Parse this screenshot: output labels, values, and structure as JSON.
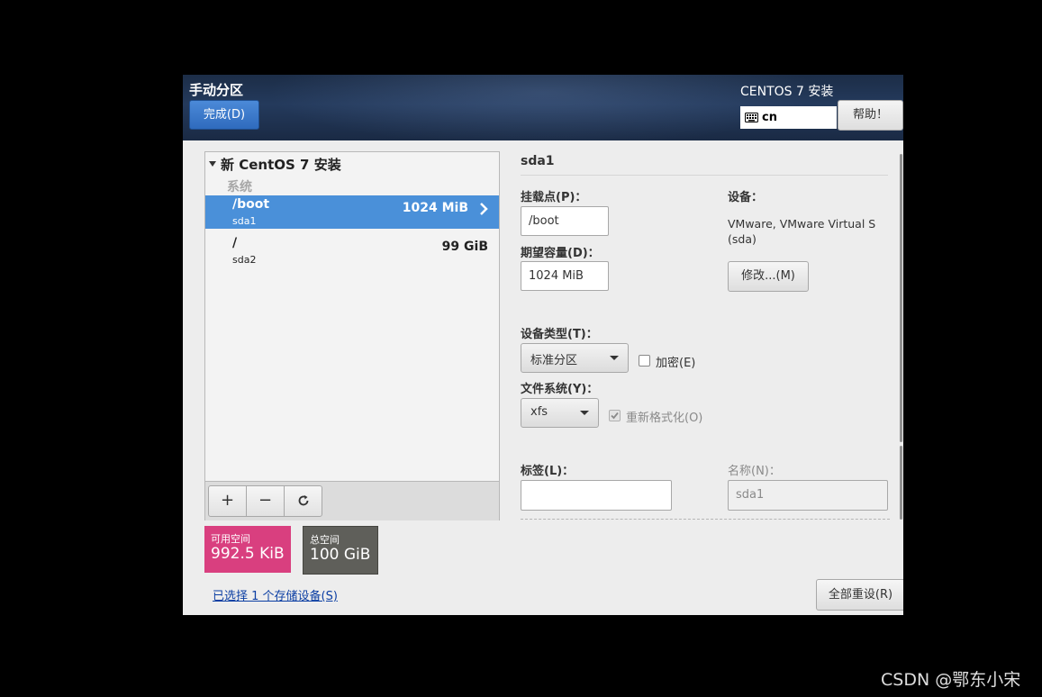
{
  "header": {
    "page_title": "手动分区",
    "done_label": "完成(D)",
    "product_title": "CENTOS 7 安装",
    "keyboard_layout": "cn",
    "help_label": "帮助！"
  },
  "tree": {
    "root_label": "新 CentOS 7 安装",
    "group_label": "系统",
    "partitions": [
      {
        "mount": "/boot",
        "device": "sda1",
        "size": "1024 MiB",
        "selected": true
      },
      {
        "mount": "/",
        "device": "sda2",
        "size": "99 GiB",
        "selected": false
      }
    ],
    "toolbar": {
      "add": "+",
      "remove": "−"
    }
  },
  "space": {
    "available_label": "可用空间",
    "available_value": "992.5 KiB",
    "total_label": "总空间",
    "total_value": "100 GiB"
  },
  "storage_link": "已选择 1 个存储设备(S)",
  "detail": {
    "title": "sda1",
    "mount_label": "挂载点(P)：",
    "mount_value": "/boot",
    "capacity_label": "期望容量(D)：",
    "capacity_value": "1024 MiB",
    "device_label": "设备：",
    "device_value": "VMware, VMware Virtual S (sda)",
    "modify_label": "修改...(M)",
    "device_type_label": "设备类型(T)：",
    "device_type_value": "标准分区",
    "encrypt_label": "加密(E)",
    "filesystem_label": "文件系统(Y)：",
    "filesystem_value": "xfs",
    "reformat_label": "重新格式化(O)",
    "tag_label": "标签(L)：",
    "tag_value": "",
    "name_label": "名称(N)：",
    "name_value": "sda1"
  },
  "reset_label": "全部重设(R)",
  "watermark": "CSDN @鄂东小宋",
  "colors": {
    "selected_row": "#4a90d9",
    "available_space": "#d93f7f",
    "total_space": "#5f5f5a",
    "done_button": "#3b7bcd"
  }
}
